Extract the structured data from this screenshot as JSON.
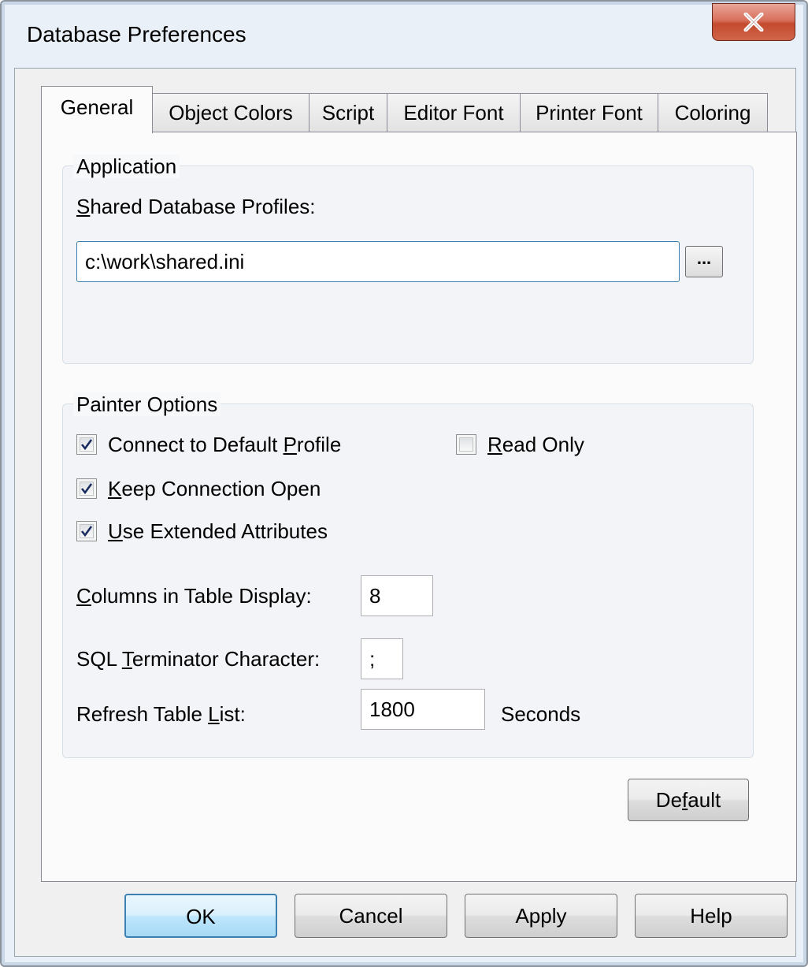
{
  "window": {
    "title": "Database Preferences",
    "close_label": "X"
  },
  "tabs": [
    {
      "label": "General",
      "active": true
    },
    {
      "label": "Object Colors",
      "active": false
    },
    {
      "label": "Script",
      "active": false
    },
    {
      "label": "Editor Font",
      "active": false
    },
    {
      "label": "Printer Font",
      "active": false
    },
    {
      "label": "Coloring",
      "active": false
    }
  ],
  "application": {
    "legend": "Application",
    "profiles_label": "Shared Database Profiles:",
    "profiles_value": "c:\\work\\shared.ini",
    "browse_label": "..."
  },
  "painter": {
    "legend": "Painter Options",
    "connect_default": {
      "label": "Connect to Default Profile",
      "checked": true
    },
    "read_only": {
      "label": "Read Only",
      "checked": false
    },
    "keep_open": {
      "label": "Keep Connection Open",
      "checked": true
    },
    "extended_attrs": {
      "label": "Use Extended Attributes",
      "checked": true
    },
    "columns_label": "Columns in Table Display:",
    "columns_value": "8",
    "terminator_label": "SQL Terminator Character:",
    "terminator_value": ";",
    "refresh_label": "Refresh Table List:",
    "refresh_value": "1800",
    "refresh_unit": "Seconds"
  },
  "default_button": "Default",
  "buttons": {
    "ok": "OK",
    "cancel": "Cancel",
    "apply": "Apply",
    "help": "Help"
  },
  "colors": {
    "close_red": "#c44a2f",
    "focus_blue": "#3c7fb1"
  }
}
